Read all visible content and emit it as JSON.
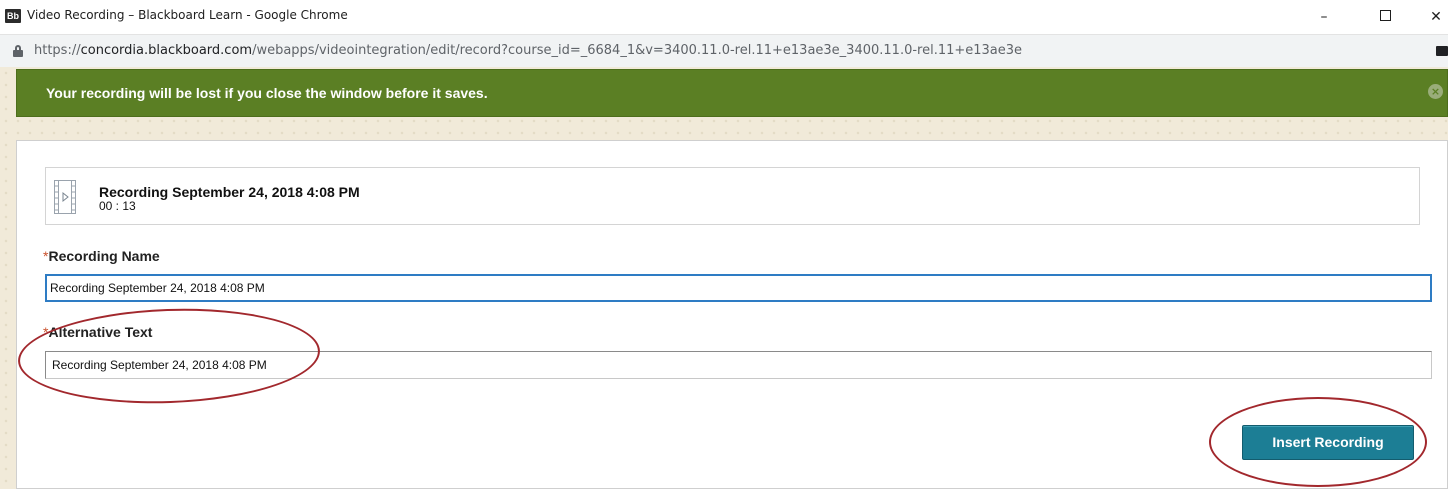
{
  "window": {
    "logo_text": "Bb",
    "title": "Video Recording – Blackboard Learn - Google Chrome",
    "minimize_glyph": "–",
    "close_glyph": "✕"
  },
  "address": {
    "scheme": "https://",
    "host": "concordia.blackboard.com",
    "path": "/webapps/videointegration/edit/record?course_id=_6684_1&v=3400.11.0-rel.11+e13ae3e_3400.11.0-rel.11+e13ae3e"
  },
  "banner": {
    "message": "Your recording will be lost if you close the window before it saves.",
    "close_glyph": "×",
    "color": "#5b7f24"
  },
  "recording": {
    "title": "Recording September 24, 2018 4:08 PM",
    "duration": "00 : 13"
  },
  "form": {
    "required_mark": "*",
    "name_label": "Recording Name",
    "name_value": "Recording September 24, 2018 4:08 PM",
    "alt_label": "Alternative Text",
    "alt_value": "Recording September 24, 2018 4:08 PM",
    "insert_button": "Insert Recording",
    "button_color": "#1c7e95"
  },
  "annotations": {
    "oval_color": "#a2282d"
  },
  "icons": {
    "logo": "blackboard-logo-icon",
    "lock": "lock-icon",
    "video": "video-file-icon",
    "banner_close": "close-circle-icon"
  }
}
